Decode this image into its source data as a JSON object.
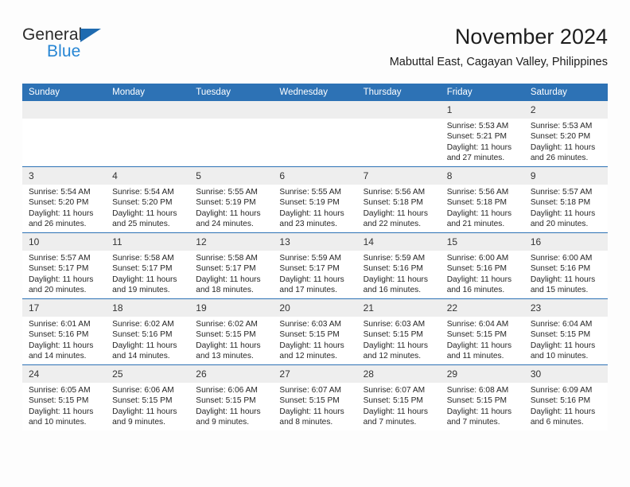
{
  "logo": {
    "word_one": "General",
    "word_two": "Blue",
    "triangle_color": "#1f6bb0",
    "word_two_color": "#2786d4"
  },
  "header": {
    "title": "November 2024",
    "subtitle": "Mabuttal East, Cagayan Valley, Philippines"
  },
  "theme": {
    "header_blue": "#2d72b5",
    "daynum_gray": "#eeeeee",
    "page_background": "#fdfdfd"
  },
  "weekday_headers": [
    "Sunday",
    "Monday",
    "Tuesday",
    "Wednesday",
    "Thursday",
    "Friday",
    "Saturday"
  ],
  "weeks": [
    [
      {
        "day": "",
        "sunrise": "",
        "sunset": "",
        "daylight": "",
        "empty": true
      },
      {
        "day": "",
        "sunrise": "",
        "sunset": "",
        "daylight": "",
        "empty": true
      },
      {
        "day": "",
        "sunrise": "",
        "sunset": "",
        "daylight": "",
        "empty": true
      },
      {
        "day": "",
        "sunrise": "",
        "sunset": "",
        "daylight": "",
        "empty": true
      },
      {
        "day": "",
        "sunrise": "",
        "sunset": "",
        "daylight": "",
        "empty": true
      },
      {
        "day": "1",
        "sunrise": "Sunrise: 5:53 AM",
        "sunset": "Sunset: 5:21 PM",
        "daylight": "Daylight: 11 hours and 27 minutes.",
        "empty": false
      },
      {
        "day": "2",
        "sunrise": "Sunrise: 5:53 AM",
        "sunset": "Sunset: 5:20 PM",
        "daylight": "Daylight: 11 hours and 26 minutes.",
        "empty": false
      }
    ],
    [
      {
        "day": "3",
        "sunrise": "Sunrise: 5:54 AM",
        "sunset": "Sunset: 5:20 PM",
        "daylight": "Daylight: 11 hours and 26 minutes.",
        "empty": false
      },
      {
        "day": "4",
        "sunrise": "Sunrise: 5:54 AM",
        "sunset": "Sunset: 5:20 PM",
        "daylight": "Daylight: 11 hours and 25 minutes.",
        "empty": false
      },
      {
        "day": "5",
        "sunrise": "Sunrise: 5:55 AM",
        "sunset": "Sunset: 5:19 PM",
        "daylight": "Daylight: 11 hours and 24 minutes.",
        "empty": false
      },
      {
        "day": "6",
        "sunrise": "Sunrise: 5:55 AM",
        "sunset": "Sunset: 5:19 PM",
        "daylight": "Daylight: 11 hours and 23 minutes.",
        "empty": false
      },
      {
        "day": "7",
        "sunrise": "Sunrise: 5:56 AM",
        "sunset": "Sunset: 5:18 PM",
        "daylight": "Daylight: 11 hours and 22 minutes.",
        "empty": false
      },
      {
        "day": "8",
        "sunrise": "Sunrise: 5:56 AM",
        "sunset": "Sunset: 5:18 PM",
        "daylight": "Daylight: 11 hours and 21 minutes.",
        "empty": false
      },
      {
        "day": "9",
        "sunrise": "Sunrise: 5:57 AM",
        "sunset": "Sunset: 5:18 PM",
        "daylight": "Daylight: 11 hours and 20 minutes.",
        "empty": false
      }
    ],
    [
      {
        "day": "10",
        "sunrise": "Sunrise: 5:57 AM",
        "sunset": "Sunset: 5:17 PM",
        "daylight": "Daylight: 11 hours and 20 minutes.",
        "empty": false
      },
      {
        "day": "11",
        "sunrise": "Sunrise: 5:58 AM",
        "sunset": "Sunset: 5:17 PM",
        "daylight": "Daylight: 11 hours and 19 minutes.",
        "empty": false
      },
      {
        "day": "12",
        "sunrise": "Sunrise: 5:58 AM",
        "sunset": "Sunset: 5:17 PM",
        "daylight": "Daylight: 11 hours and 18 minutes.",
        "empty": false
      },
      {
        "day": "13",
        "sunrise": "Sunrise: 5:59 AM",
        "sunset": "Sunset: 5:17 PM",
        "daylight": "Daylight: 11 hours and 17 minutes.",
        "empty": false
      },
      {
        "day": "14",
        "sunrise": "Sunrise: 5:59 AM",
        "sunset": "Sunset: 5:16 PM",
        "daylight": "Daylight: 11 hours and 16 minutes.",
        "empty": false
      },
      {
        "day": "15",
        "sunrise": "Sunrise: 6:00 AM",
        "sunset": "Sunset: 5:16 PM",
        "daylight": "Daylight: 11 hours and 16 minutes.",
        "empty": false
      },
      {
        "day": "16",
        "sunrise": "Sunrise: 6:00 AM",
        "sunset": "Sunset: 5:16 PM",
        "daylight": "Daylight: 11 hours and 15 minutes.",
        "empty": false
      }
    ],
    [
      {
        "day": "17",
        "sunrise": "Sunrise: 6:01 AM",
        "sunset": "Sunset: 5:16 PM",
        "daylight": "Daylight: 11 hours and 14 minutes.",
        "empty": false
      },
      {
        "day": "18",
        "sunrise": "Sunrise: 6:02 AM",
        "sunset": "Sunset: 5:16 PM",
        "daylight": "Daylight: 11 hours and 14 minutes.",
        "empty": false
      },
      {
        "day": "19",
        "sunrise": "Sunrise: 6:02 AM",
        "sunset": "Sunset: 5:15 PM",
        "daylight": "Daylight: 11 hours and 13 minutes.",
        "empty": false
      },
      {
        "day": "20",
        "sunrise": "Sunrise: 6:03 AM",
        "sunset": "Sunset: 5:15 PM",
        "daylight": "Daylight: 11 hours and 12 minutes.",
        "empty": false
      },
      {
        "day": "21",
        "sunrise": "Sunrise: 6:03 AM",
        "sunset": "Sunset: 5:15 PM",
        "daylight": "Daylight: 11 hours and 12 minutes.",
        "empty": false
      },
      {
        "day": "22",
        "sunrise": "Sunrise: 6:04 AM",
        "sunset": "Sunset: 5:15 PM",
        "daylight": "Daylight: 11 hours and 11 minutes.",
        "empty": false
      },
      {
        "day": "23",
        "sunrise": "Sunrise: 6:04 AM",
        "sunset": "Sunset: 5:15 PM",
        "daylight": "Daylight: 11 hours and 10 minutes.",
        "empty": false
      }
    ],
    [
      {
        "day": "24",
        "sunrise": "Sunrise: 6:05 AM",
        "sunset": "Sunset: 5:15 PM",
        "daylight": "Daylight: 11 hours and 10 minutes.",
        "empty": false
      },
      {
        "day": "25",
        "sunrise": "Sunrise: 6:06 AM",
        "sunset": "Sunset: 5:15 PM",
        "daylight": "Daylight: 11 hours and 9 minutes.",
        "empty": false
      },
      {
        "day": "26",
        "sunrise": "Sunrise: 6:06 AM",
        "sunset": "Sunset: 5:15 PM",
        "daylight": "Daylight: 11 hours and 9 minutes.",
        "empty": false
      },
      {
        "day": "27",
        "sunrise": "Sunrise: 6:07 AM",
        "sunset": "Sunset: 5:15 PM",
        "daylight": "Daylight: 11 hours and 8 minutes.",
        "empty": false
      },
      {
        "day": "28",
        "sunrise": "Sunrise: 6:07 AM",
        "sunset": "Sunset: 5:15 PM",
        "daylight": "Daylight: 11 hours and 7 minutes.",
        "empty": false
      },
      {
        "day": "29",
        "sunrise": "Sunrise: 6:08 AM",
        "sunset": "Sunset: 5:15 PM",
        "daylight": "Daylight: 11 hours and 7 minutes.",
        "empty": false
      },
      {
        "day": "30",
        "sunrise": "Sunrise: 6:09 AM",
        "sunset": "Sunset: 5:16 PM",
        "daylight": "Daylight: 11 hours and 6 minutes.",
        "empty": false
      }
    ]
  ]
}
